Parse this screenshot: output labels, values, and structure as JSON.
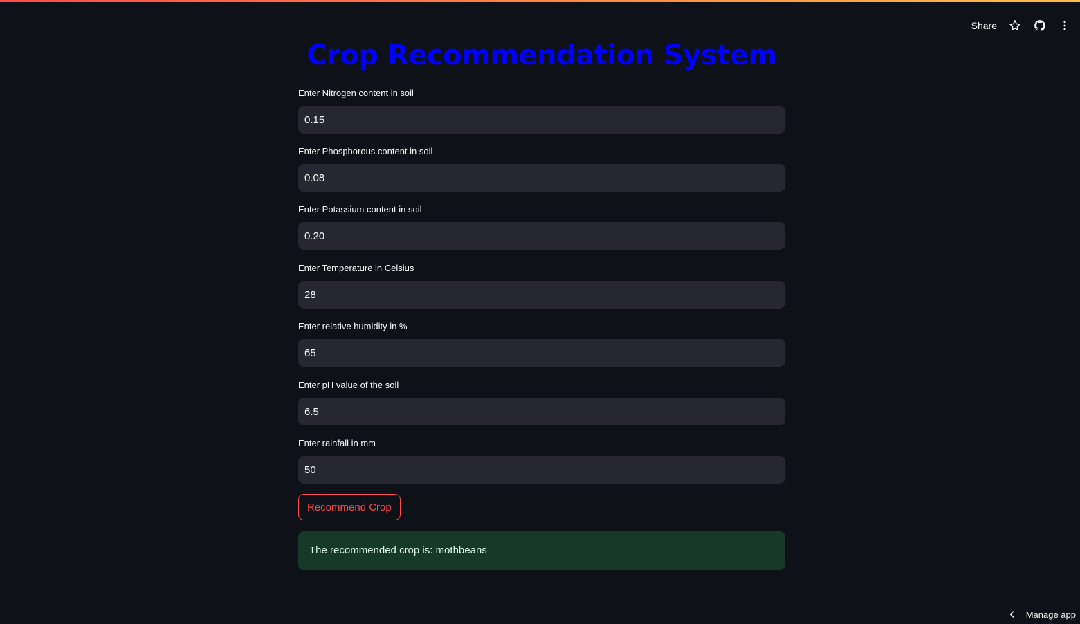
{
  "header": {
    "share_label": "Share",
    "icons": [
      "star-icon",
      "github-icon",
      "more-vertical-icon"
    ]
  },
  "title": "Crop Recommendation System",
  "fields": [
    {
      "label": "Enter Nitrogen content in soil",
      "value": "0.15"
    },
    {
      "label": "Enter Phosphorous content in soil",
      "value": "0.08"
    },
    {
      "label": "Enter Potassium content in soil",
      "value": "0.20"
    },
    {
      "label": "Enter Temperature in Celsius",
      "value": "28"
    },
    {
      "label": "Enter relative humidity in %",
      "value": "65"
    },
    {
      "label": "Enter pH value of the soil",
      "value": "6.5"
    },
    {
      "label": "Enter rainfall in mm",
      "value": "50"
    }
  ],
  "recommend_button_label": "Recommend Crop",
  "result_text": "The recommended crop is: mothbeans",
  "footer": {
    "manage_app_label": "Manage app"
  },
  "colors": {
    "background": "#0e1117",
    "title": "#0000ff",
    "input_bg": "#262730",
    "button_accent": "#ff4b4b",
    "success_bg": "#173928"
  }
}
